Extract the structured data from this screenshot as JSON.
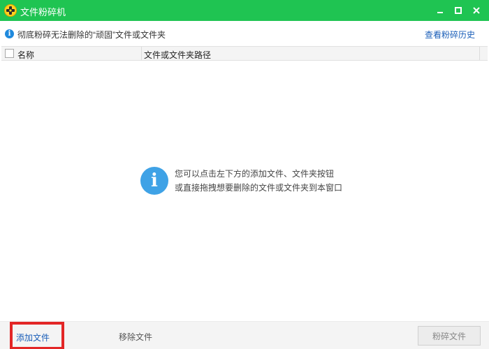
{
  "window": {
    "title": "文件粉碎机",
    "logo_icon": "360-logo-icon",
    "controls": [
      "minimize-icon",
      "maximize-icon",
      "close-icon"
    ]
  },
  "infobar": {
    "icon": "info-icon",
    "text": "彻底粉碎无法删除的“顽固”文件或文件夹",
    "history_link": "查看粉碎历史"
  },
  "table": {
    "columns": [
      "名称",
      "文件或文件夹路径"
    ],
    "rows": []
  },
  "empty_state": {
    "icon": "info-icon",
    "line1": "您可以点击左下方的添加文件、文件夹按钮",
    "line2": "或直接拖拽想要删除的文件或文件夹到本窗口"
  },
  "footer": {
    "add_file": "添加文件",
    "remove_file": "移除文件",
    "shred": "粉碎文件"
  },
  "colors": {
    "titlebar": "#1fc452",
    "link": "#1a5eb8",
    "info_blue": "#3fa2e6",
    "highlight_border": "#e32626"
  }
}
